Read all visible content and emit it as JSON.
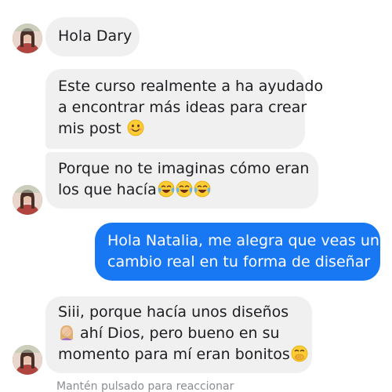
{
  "conversation": {
    "messages": [
      {
        "sender": "other",
        "lines": [
          "Hola Dary"
        ]
      },
      {
        "sender": "other",
        "lines": [
          "Este curso realmente a ha ayudado",
          "a encontrar más ideas para crear",
          "mis post "
        ],
        "emojis": [
          "smiling-face"
        ]
      },
      {
        "sender": "other",
        "lines": [
          "Porque no te imaginas cómo eran",
          "los que hacía"
        ],
        "emojis": [
          "tears-of-joy",
          "tears-of-joy",
          "tears-of-joy"
        ]
      },
      {
        "sender": "me",
        "lines": [
          "Hola Natalia, me alegra que veas un",
          "cambio real en tu forma de diseñar"
        ]
      },
      {
        "sender": "other",
        "lines": [
          "Siii, porque hacía unos diseños",
          " ahí Dios, pero bueno en su",
          "momento para mí eran bonitos"
        ],
        "emojis": [
          "woman-facepalming",
          "face-with-hand-over-mouth"
        ]
      }
    ]
  },
  "footer": {
    "hint": "Mantén pulsado para reaccionar"
  },
  "colors": {
    "incoming_bubble": "#f0f0f0",
    "outgoing_bubble": "#1877f2",
    "hint_text": "#8a8d91"
  }
}
